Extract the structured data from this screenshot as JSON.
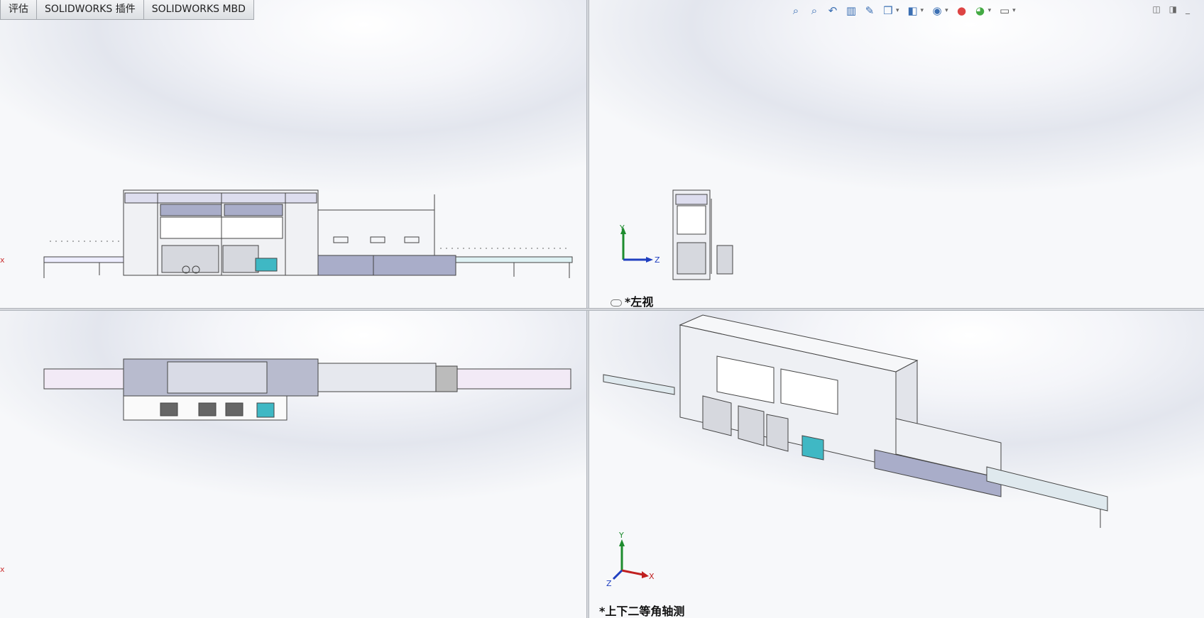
{
  "tabs": [
    "评估",
    "SOLIDWORKS 插件",
    "SOLIDWORKS MBD"
  ],
  "views": {
    "left_view_label": "*左视",
    "iso_view_label": "*上下二等角轴测"
  },
  "triad": {
    "y": "Y",
    "z": "Z",
    "x": "X"
  },
  "hud_icons": [
    "zoom-to-fit-icon",
    "zoom-area-icon",
    "previous-view-icon",
    "section-view-icon",
    "dynamic-annotation-icon",
    "view-orientation-icon",
    "display-style-icon",
    "hide-show-icon",
    "edit-appearance-icon",
    "apply-scene-icon",
    "view-settings-icon"
  ],
  "colors": {
    "accent_cyan": "#3fb8c4",
    "panel_blue": "#a9adc9",
    "line": "#444444"
  }
}
